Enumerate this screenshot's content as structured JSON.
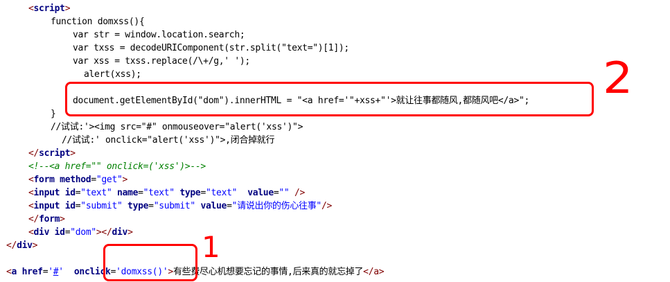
{
  "code": {
    "l1": {
      "open": "<",
      "name": "script",
      "close": ">"
    },
    "l2": "function domxss(){",
    "l3": "var str = window.location.search;",
    "l4": "var txss = decodeURIComponent(str.split(\"text=\")[1]);",
    "l5": "var xss = txss.replace(/\\+/g,' ');",
    "l6": "alert(xss);",
    "l7": "document.getElementById(\"dom\").innerHTML = \"<a href='\"+xss+\"'>就让往事都随风,都随风吧</a>\";",
    "l8": "}",
    "l9": "//试试:'><img src=\"#\" onmouseover=\"alert('xss')\">",
    "l10": "//试试:' onclick=\"alert('xss')\">,闭合掉就行",
    "l11": {
      "open": "</",
      "name": "script",
      "close": ">"
    },
    "l12": "<!--<a href=\"\" onclick=('xss')>-->",
    "l13": {
      "open": "<",
      "name": "form",
      "attr": "method",
      "eq": "=",
      "value": "\"get\"",
      "close": ">"
    },
    "l14": {
      "open": "<",
      "name": "input",
      "a1": "id",
      "v1": "\"text\"",
      "a2": "name",
      "v2": "\"text\"",
      "a3": "type",
      "v3": "\"text\"",
      "a4": "value",
      "v4": "\"\"",
      "close": "/>"
    },
    "l15": {
      "open": "<",
      "name": "input",
      "a1": "id",
      "v1": "\"submit\"",
      "a2": "type",
      "v2": "\"submit\"",
      "a3": "value",
      "v3": "\"请说出你的伤心往事\"",
      "close": "/>"
    },
    "l16": {
      "open": "</",
      "name": "form",
      "close": ">"
    },
    "l17": {
      "open": "<",
      "name": "div",
      "attr": "id",
      "value": "\"dom\"",
      "mid": "></",
      "name2": "div",
      "close": ">"
    },
    "l18": {
      "open": "</",
      "name": "div",
      "close": ">"
    },
    "l20": {
      "open": "<",
      "name": "a",
      "a1": "href",
      "eq": "=",
      "q1": "'",
      "href": "#",
      "q2": "'",
      "a2a": "oncl",
      "a2b": "ick",
      "eq2": "=",
      "v2": "'domxss()'",
      "close": ">",
      "text": "有些费尽心机想要忘记的事情,后来真的就忘掉了",
      "end": "</a>"
    }
  },
  "annotations": {
    "mark1": "1",
    "mark2": "2"
  },
  "colors": {
    "highlight": "#ff0000",
    "tag": "#800000",
    "attr": "#ff0000",
    "value": "#0000ff",
    "comment": "#008000"
  }
}
